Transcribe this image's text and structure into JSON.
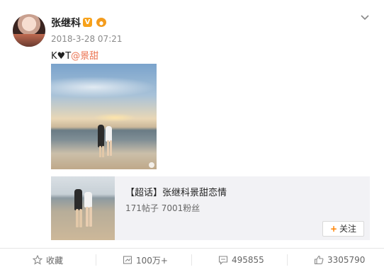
{
  "post": {
    "username": "张继科",
    "verified_badge": "V",
    "timestamp": "2018-3-28 07:21",
    "text_prefix": "K",
    "text_heart": "♥",
    "text_middle": "T",
    "mention": "@景甜"
  },
  "topic_card": {
    "title": "【超话】张继科景甜恋情",
    "stats": "171帖子 7001粉丝",
    "follow_label": "关注",
    "follow_plus": "+"
  },
  "actions": {
    "favorite_label": "收藏",
    "repost_count": "100万+",
    "comment_count": "495855",
    "like_count": "3305790"
  },
  "icons": [
    "avatar",
    "verified-badge",
    "crown-icon",
    "chevron-down-icon",
    "star-icon",
    "repost-icon",
    "comment-icon",
    "like-icon"
  ],
  "colors": {
    "mention": "#eb7350",
    "accent": "#ff8200",
    "badge": "#f7a21b"
  }
}
